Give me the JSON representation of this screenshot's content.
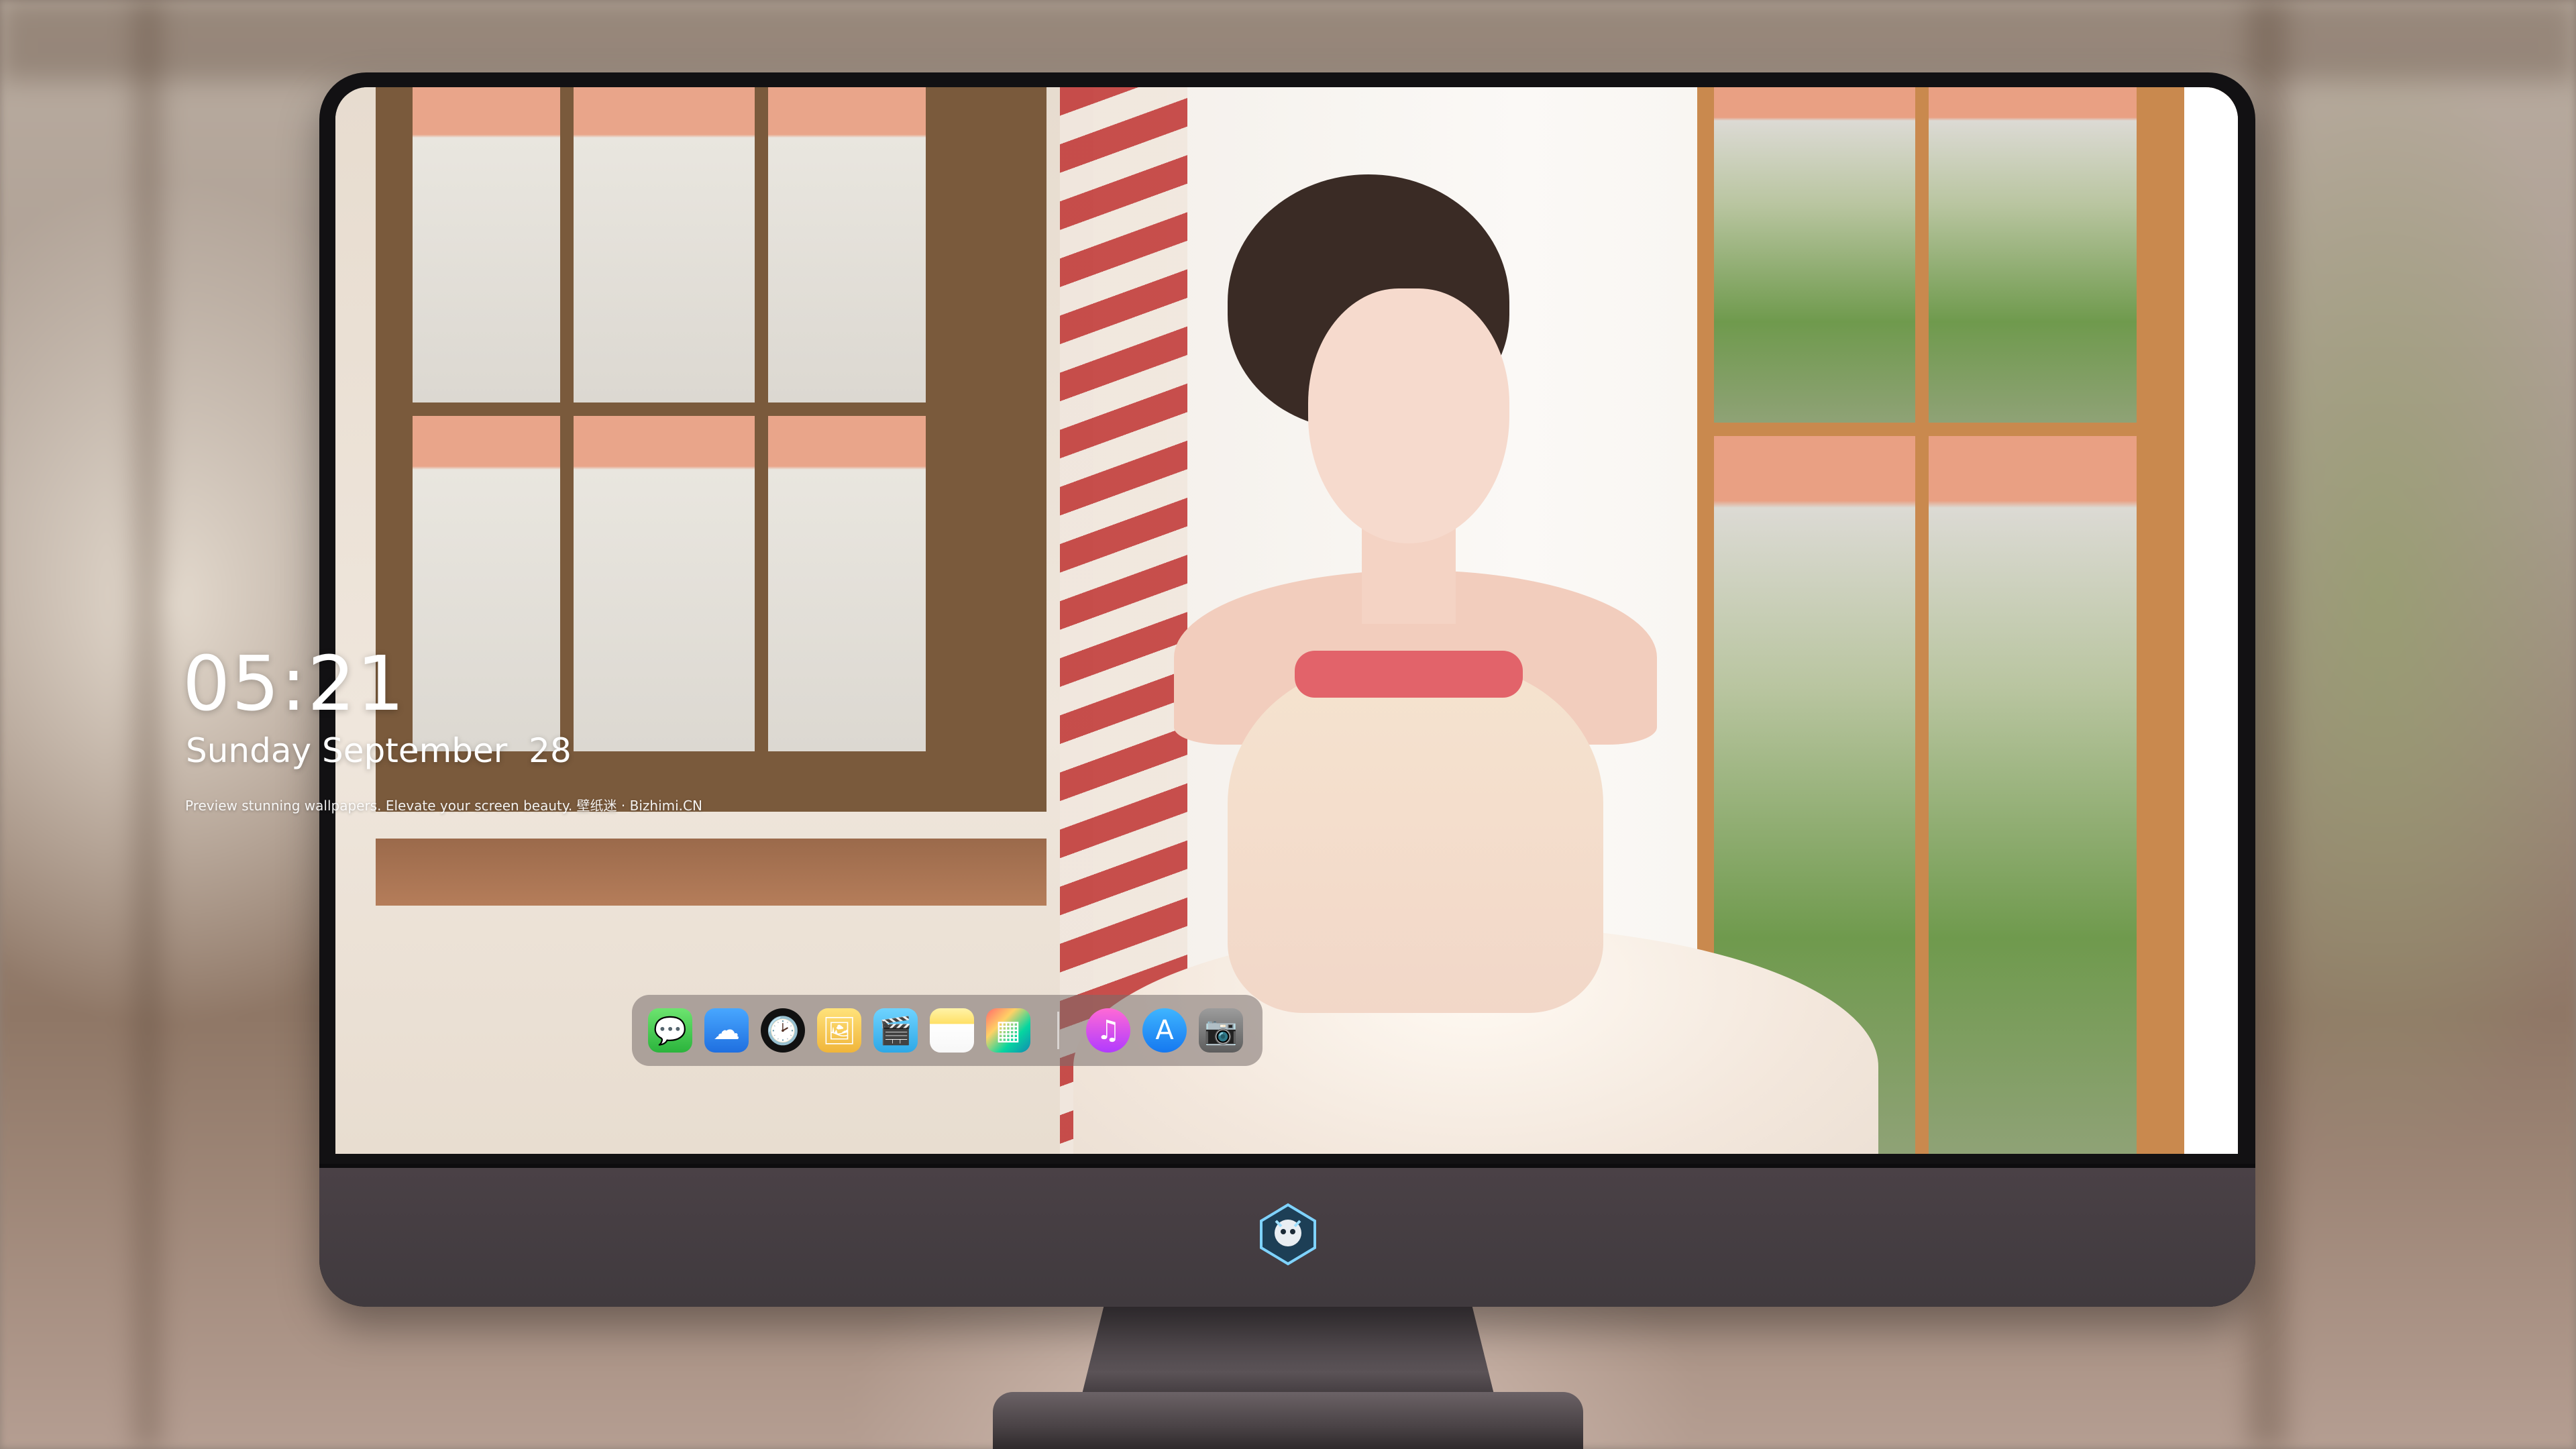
{
  "lockscreen": {
    "time": "05:21",
    "date": "Sunday September  28",
    "caption": "Preview stunning wallpapers. Elevate your screen beauty. 壁纸迷 · Bizhimi.CN"
  },
  "dock": {
    "apps": [
      {
        "name": "messages-icon",
        "glyph": "💬"
      },
      {
        "name": "weather-icon",
        "glyph": "☁"
      },
      {
        "name": "clock-icon",
        "glyph": "🕑"
      },
      {
        "name": "preview-icon",
        "glyph": "🖼"
      },
      {
        "name": "clapper-icon",
        "glyph": "🎬"
      },
      {
        "name": "notes-icon",
        "glyph": ""
      },
      {
        "name": "photos-icon",
        "glyph": "▦"
      },
      {
        "name": "music-icon",
        "glyph": "♫"
      },
      {
        "name": "app-store-icon",
        "glyph": "A"
      },
      {
        "name": "camera-icon",
        "glyph": "📷"
      }
    ]
  },
  "branding": {
    "logo_icon": "dragon-mascot-icon"
  },
  "colors": {
    "bezel": "#121113",
    "chin": "#443d42",
    "dock_bg": "rgba(120,110,108,0.55)"
  }
}
